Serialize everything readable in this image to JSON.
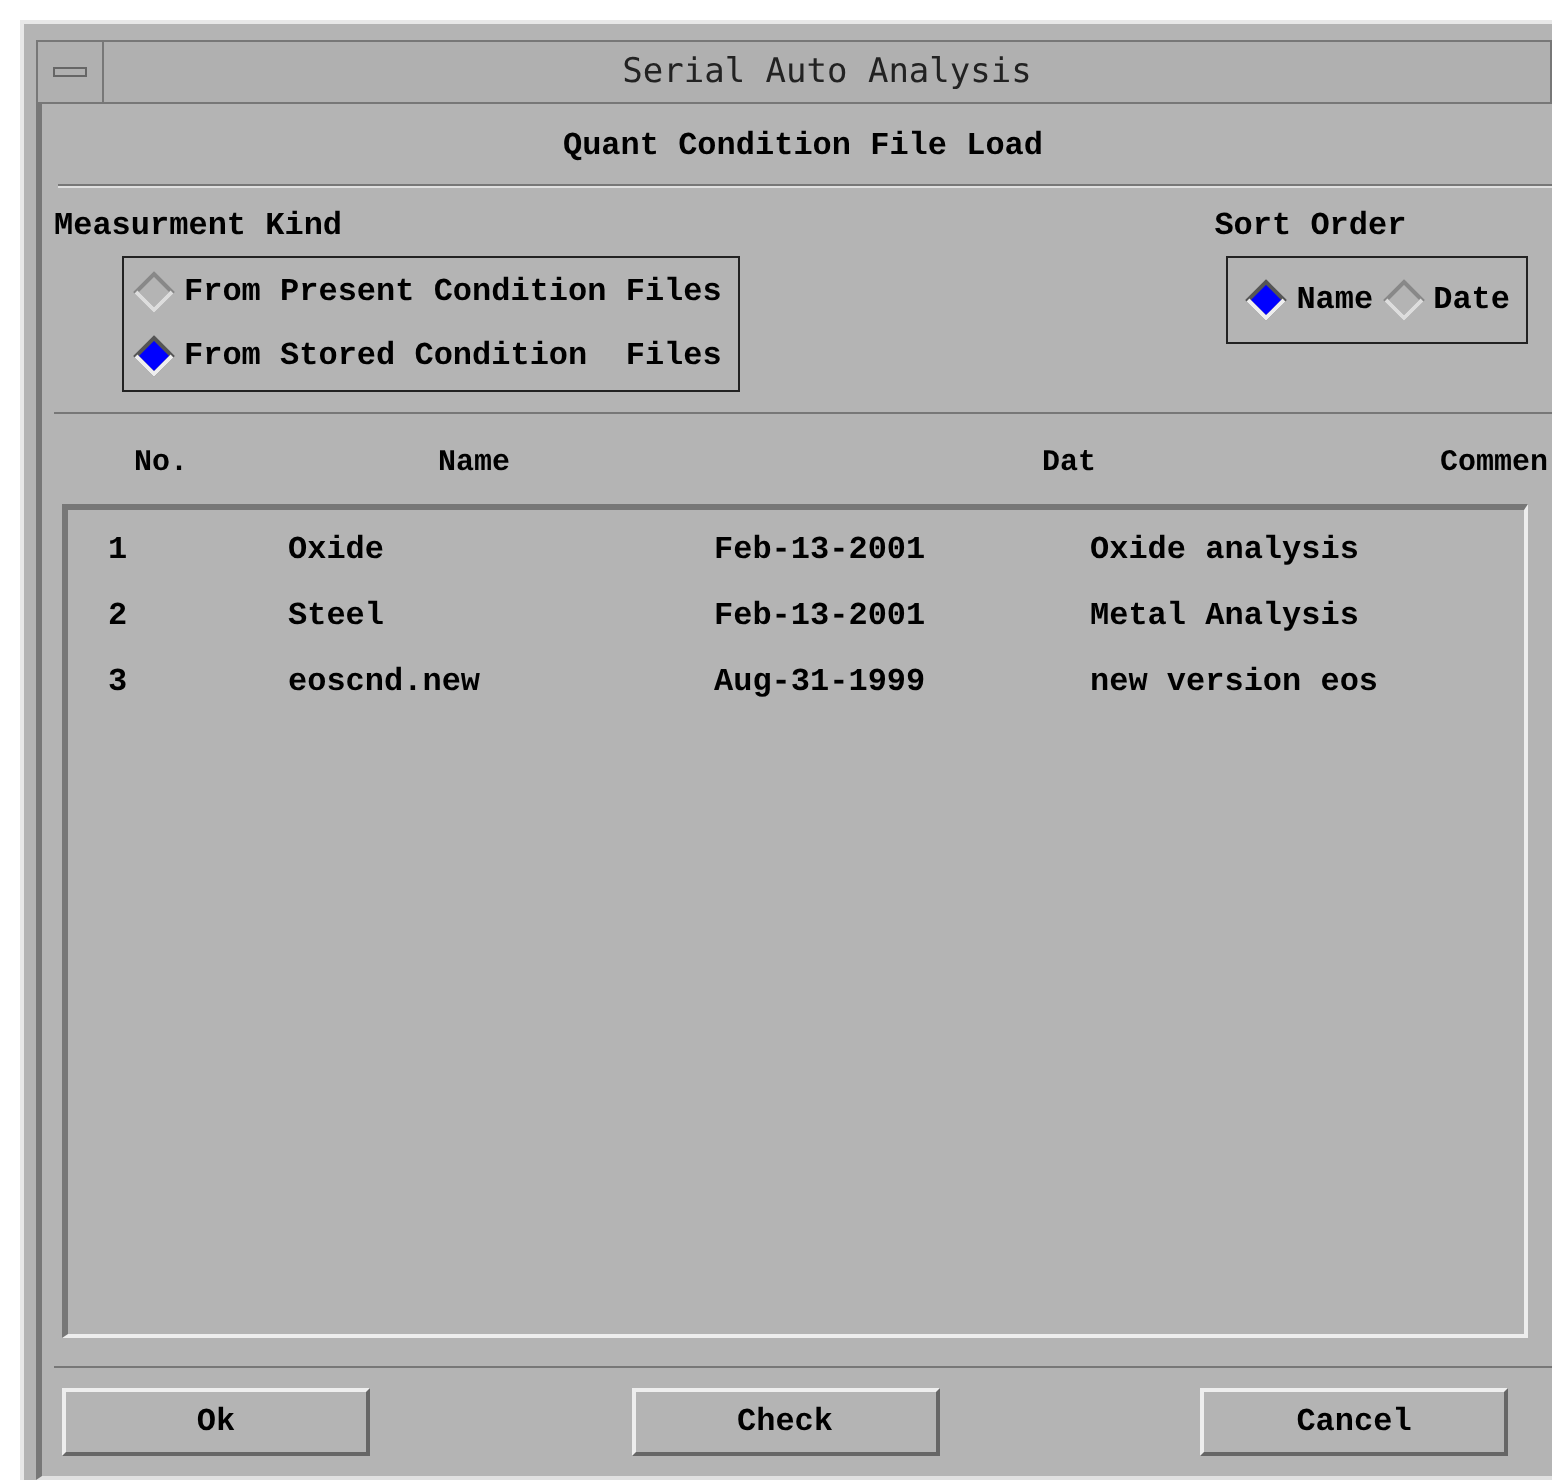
{
  "window": {
    "title": "Serial Auto Analysis"
  },
  "dialog_title": "Quant Condition File Load",
  "measurement_kind": {
    "label": "Measurment Kind",
    "options": [
      {
        "label": "From Present Condition Files",
        "selected": false
      },
      {
        "label": "From Stored Condition  Files",
        "selected": true
      }
    ]
  },
  "sort_order": {
    "label": "Sort Order",
    "options": [
      {
        "label": "Name",
        "selected": true
      },
      {
        "label": "Date",
        "selected": false
      }
    ]
  },
  "table": {
    "columns": [
      "No.",
      "Name",
      "Dat",
      "Commen"
    ],
    "rows": [
      [
        "1",
        "Oxide",
        "Feb-13-2001",
        "Oxide analysis"
      ],
      [
        "2",
        "Steel",
        "Feb-13-2001",
        "Metal Analysis"
      ],
      [
        "3",
        "eoscnd.new",
        "Aug-31-1999",
        "new version eos"
      ]
    ]
  },
  "buttons": [
    "Ok",
    "Check",
    "Cancel"
  ]
}
